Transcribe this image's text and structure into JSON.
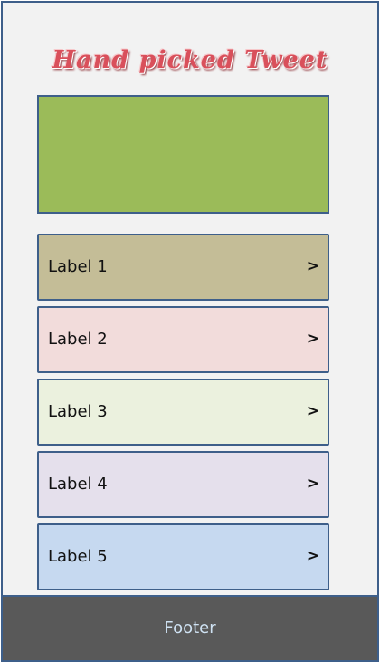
{
  "header": {
    "title": "Hand picked Tweet",
    "title_color": "#d9505b"
  },
  "hero": {
    "color": "#9bbb59"
  },
  "list": {
    "chevron": ">",
    "items": [
      {
        "label": "Label 1",
        "color": "#c4bd97"
      },
      {
        "label": "Label 2",
        "color": "#f2dcdb"
      },
      {
        "label": "Label 3",
        "color": "#ebf1de"
      },
      {
        "label": "Label 4",
        "color": "#e5e0ec"
      },
      {
        "label": "Label 5",
        "color": "#c6d9f0"
      }
    ]
  },
  "footer": {
    "label": "Footer",
    "color": "#595959"
  },
  "accent_border_color": "#3e5f8a"
}
